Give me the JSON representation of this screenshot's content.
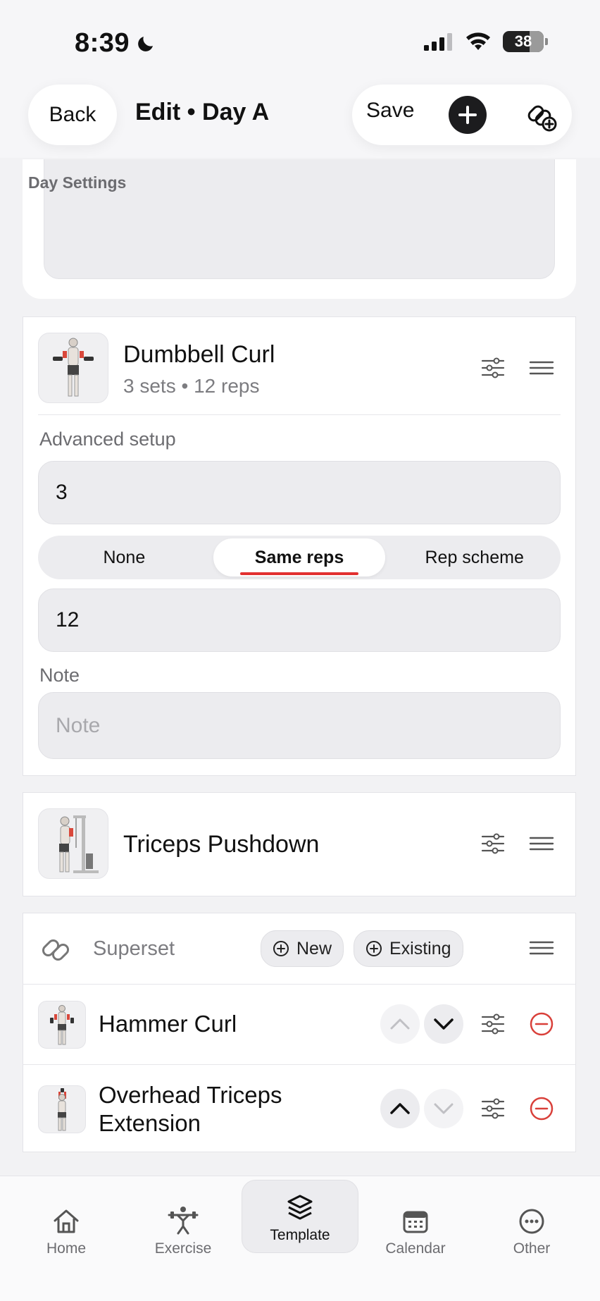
{
  "status_bar": {
    "time": "8:39",
    "battery": "38"
  },
  "header": {
    "back_label": "Back",
    "title": "Edit • Day A",
    "save_label": "Save"
  },
  "day_settings": {
    "label": "Day Settings"
  },
  "exercise_1": {
    "name": "Dumbbell Curl",
    "summary": "3 sets • 12 reps",
    "advanced_label": "Advanced setup",
    "sets_value": "3",
    "rep_mode": {
      "options": [
        "None",
        "Same reps",
        "Rep scheme"
      ],
      "selected": "Same reps"
    },
    "reps_value": "12",
    "note_label": "Note",
    "note_placeholder": "Note"
  },
  "exercise_2": {
    "name": "Triceps Pushdown"
  },
  "superset": {
    "label": "Superset",
    "new_label": "New",
    "existing_label": "Existing",
    "items": [
      {
        "name": "Hammer Curl"
      },
      {
        "name_line1": "Overhead Triceps",
        "name_line2": "Extension"
      }
    ]
  },
  "tabs": [
    {
      "label": "Home"
    },
    {
      "label": "Exercise"
    },
    {
      "label": "Template",
      "active": true
    },
    {
      "label": "Calendar"
    },
    {
      "label": "Other"
    }
  ],
  "colors": {
    "accent_red": "#e23030",
    "dark": "#1c1c1e",
    "remove_red": "#d9403a"
  }
}
